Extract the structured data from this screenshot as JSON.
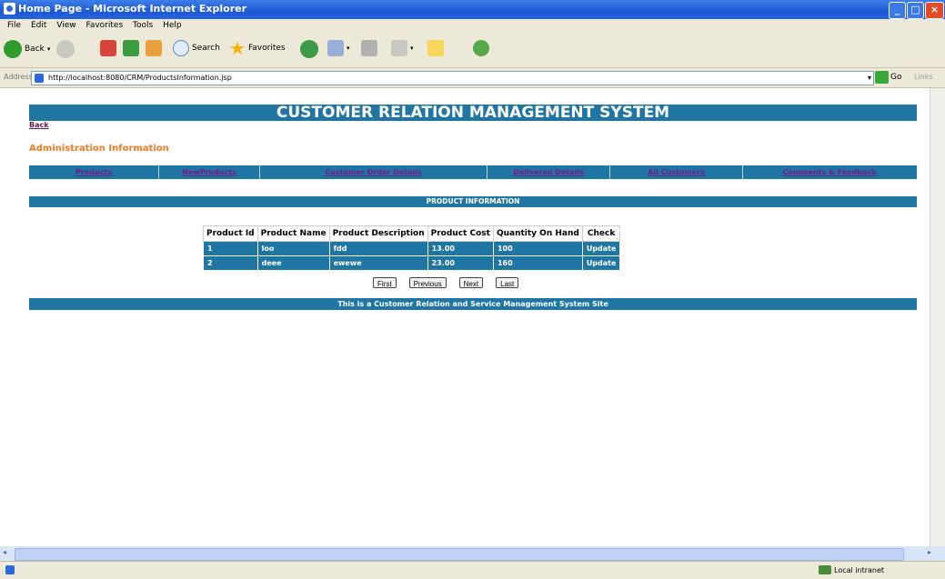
{
  "window": {
    "title": "Home Page - Microsoft Internet Explorer"
  },
  "menu": [
    "File",
    "Edit",
    "View",
    "Favorites",
    "Tools",
    "Help"
  ],
  "toolbar": {
    "back": "Back",
    "search": "Search",
    "favorites": "Favorites"
  },
  "address": {
    "label": "Address",
    "url": "http://localhost:8080/CRM/ProductsInformation.jsp",
    "go": "Go",
    "links": "Links"
  },
  "page": {
    "header": "CUSTOMER RELATION MANAGEMENT SYSTEM",
    "back_link": "Back",
    "section_title": "Administration Information",
    "nav": [
      "Products",
      "NewProducts",
      "Customer Order Details",
      "Delivered Details",
      "All Customers",
      "Comments & Feedback"
    ],
    "table_title": "PRODUCT INFORMATION",
    "table": {
      "headers": [
        "Product Id",
        "Product Name",
        "Product Description",
        "Product Cost",
        "Quantity On Hand",
        "Check"
      ],
      "rows": [
        [
          "1",
          "loo",
          "fdd",
          "13.00",
          "100",
          "Update"
        ],
        [
          "2",
          "deee",
          "ewewe",
          "23.00",
          "160",
          "Update"
        ]
      ]
    },
    "pager": [
      "First",
      "Previous",
      "Next",
      "Last"
    ],
    "footer": "This is a Customer Relation and Service Management System Site"
  },
  "status": {
    "zone": "Local intranet"
  },
  "colors": {
    "brand": "#1f76a2",
    "accent": "#f07a22",
    "link": "#6f1f8a"
  }
}
